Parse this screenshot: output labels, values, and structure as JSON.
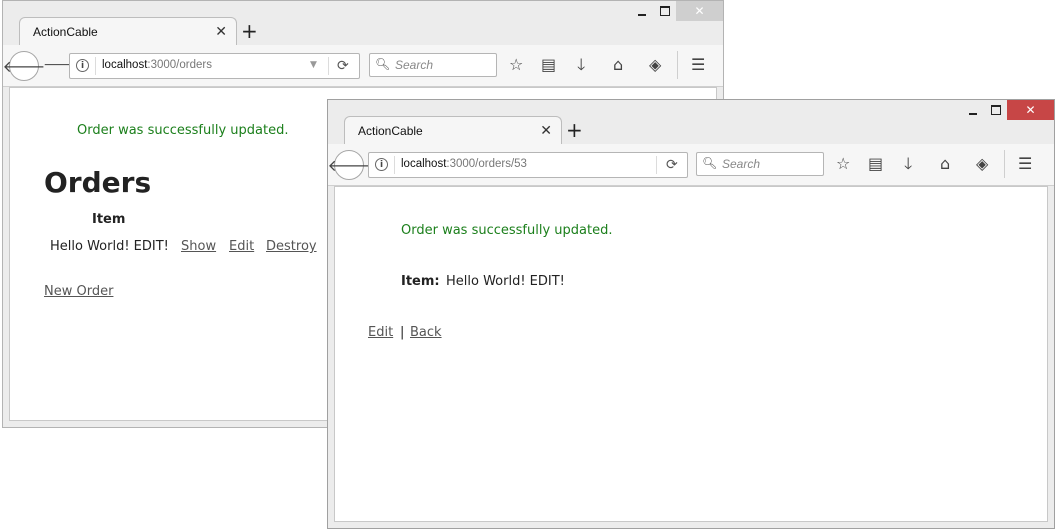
{
  "windows": [
    {
      "tab_title": "ActionCable",
      "url_host": "localhost",
      "url_path": ":3000/orders",
      "search_placeholder": "Search",
      "page": {
        "notice": "Order was successfully updated.",
        "heading": "Orders",
        "table": {
          "headers": [
            "Item"
          ],
          "rows": [
            {
              "item": "Hello World! EDIT!",
              "show": "Show",
              "edit": "Edit",
              "destroy": "Destroy"
            }
          ]
        },
        "new_link": "New Order"
      }
    },
    {
      "tab_title": "ActionCable",
      "url_host": "localhost",
      "url_path": ":3000/orders/53",
      "search_placeholder": "Search",
      "page": {
        "notice": "Order was successfully updated.",
        "item_label": "Item:",
        "item_value": "Hello World! EDIT!",
        "edit_link": "Edit",
        "separator": "|",
        "back_link": "Back"
      }
    }
  ],
  "icons": {
    "back": "arrow-left-icon",
    "forward": "arrow-right-icon",
    "info": "info-icon",
    "reload": "reload-icon",
    "search": "search-icon",
    "bookmark": "star-icon",
    "reading_list": "clipboard-icon",
    "download": "download-icon",
    "home": "home-icon",
    "pocket": "pocket-icon",
    "menu": "hamburger-menu-icon"
  },
  "colors": {
    "notice": "#1b7f1b",
    "close_active": "#c74646"
  }
}
